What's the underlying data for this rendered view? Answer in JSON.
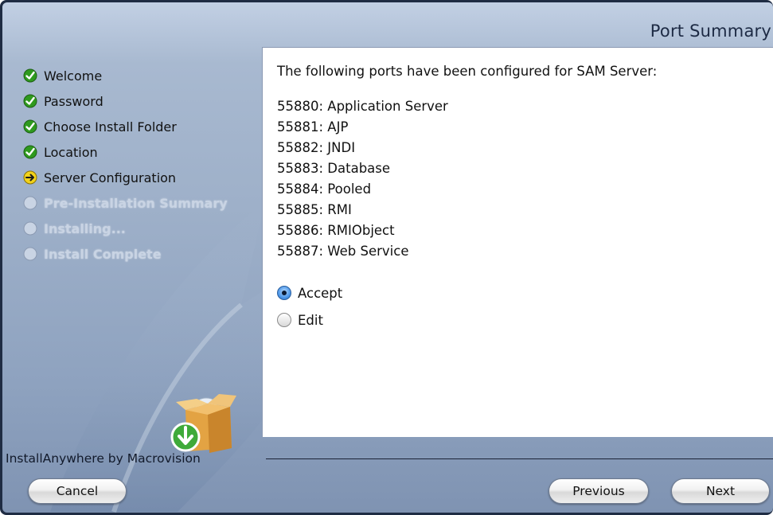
{
  "header": {
    "title": "Port Summary"
  },
  "steps": [
    {
      "label": "Welcome",
      "state": "done"
    },
    {
      "label": "Password",
      "state": "done"
    },
    {
      "label": "Choose Install Folder",
      "state": "done"
    },
    {
      "label": "Location",
      "state": "done"
    },
    {
      "label": "Server Configuration",
      "state": "current"
    },
    {
      "label": "Pre-Installation Summary",
      "state": "pending"
    },
    {
      "label": "Installing...",
      "state": "pending"
    },
    {
      "label": "Install Complete",
      "state": "pending"
    }
  ],
  "content": {
    "intro": "The following ports have been configured for SAM Server:",
    "ports": [
      "55880: Application Server",
      "55881: AJP",
      "55882: JNDI",
      "55883: Database",
      "55884: Pooled",
      "55885: RMI",
      "55886: RMIObject",
      "55887: Web Service"
    ],
    "options": [
      {
        "label": "Accept",
        "selected": true
      },
      {
        "label": "Edit",
        "selected": false
      }
    ]
  },
  "branding": {
    "text": "InstallAnywhere by Macrovision"
  },
  "buttons": {
    "cancel": "Cancel",
    "previous": "Previous",
    "next": "Next"
  },
  "colors": {
    "done": "#2f9a1e",
    "current": "#f2d21b",
    "pending": "#c9d4e4",
    "accent": "#4d97e8"
  },
  "icons": {
    "done": "check-circle-icon",
    "current": "arrow-circle-icon",
    "pending": "empty-circle-icon"
  }
}
